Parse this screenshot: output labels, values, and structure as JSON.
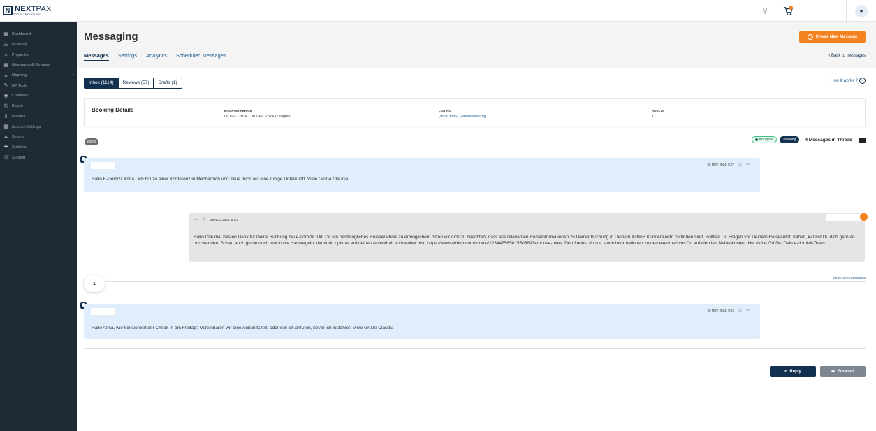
{
  "brand": {
    "logo_mark": "N",
    "name_a": "NEXT",
    "name_b": "PAX",
    "tagline": "TRAVEL TECHNOLOGY"
  },
  "topbar": {
    "search_icon": "search-icon",
    "cart_icon": "cart-icon",
    "user_icon": "user-icon"
  },
  "sidebar": {
    "items": [
      {
        "label": "Dashboard",
        "icon": "▦",
        "chevron": ""
      },
      {
        "label": "Bookings",
        "icon": "▭",
        "chevron": ""
      },
      {
        "label": "Properties",
        "icon": "⌂",
        "chevron": ""
      },
      {
        "label": "Messaging & Reviews",
        "icon": "▦",
        "chevron": ""
      },
      {
        "label": "Mapping",
        "icon": "⅄",
        "chevron": "›"
      },
      {
        "label": "NP Tools",
        "icon": "✎",
        "chevron": ""
      },
      {
        "label": "Channels",
        "icon": "◉",
        "chevron": ""
      },
      {
        "label": "Export",
        "icon": "⇱",
        "chevron": "›"
      },
      {
        "label": "Reports",
        "icon": "▯",
        "chevron": ""
      },
      {
        "label": "Account Settings",
        "icon": "▦",
        "chevron": ""
      },
      {
        "label": "System",
        "icon": "✲",
        "chevron": "›"
      },
      {
        "label": "Statistics",
        "icon": "✚",
        "chevron": ""
      },
      {
        "label": "Support",
        "icon": "☏",
        "chevron": ""
      }
    ]
  },
  "header": {
    "title": "Messaging",
    "create_button": "Create New Message",
    "tabs": [
      "Messages",
      "Settings",
      "Analytics",
      "Scheduled Messages"
    ],
    "back_link": "‹  Back to messages"
  },
  "folders": {
    "inbox": "Inbox (1114)",
    "reviews": "Reviews (57)",
    "drafts": "Drafts (1)",
    "how_it_works": "How it works ?",
    "help_glyph": "?"
  },
  "booking": {
    "title": "Booking Details",
    "period_label": "BOOKING PERIOD",
    "period_value": "06 DEC 2024 - 08 DEC 2024 (2 Nights)",
    "listing_label": "LISTING",
    "listing_id": "(99963385)",
    "listing_name": " Ferienwohnung",
    "adults_label": "ADULTS",
    "adults_value": "1"
  },
  "thread": {
    "folder_pill": "Inbox",
    "status_pill": "Accepted",
    "type_pill": "Booking",
    "count_text": "4 Messages in Thread"
  },
  "messages": [
    {
      "direction": "in",
      "date": "25 NOV 2024, 8:07",
      "text": "Hallo E-Domizil Anna , ich bin zu einer Konferenz in Mechernich und freue mich auf eine ruhige Unterkunft. Viele Grüße Claudia"
    },
    {
      "direction": "out",
      "date": "28 NOV 2024, 8:10",
      "text": "Hallo Claudia, besten Dank für Deine Buchung bei e-domizil. Um Dir ein bestmögliches Reiseerlebnis zu ermöglichen, bitten wir dich zu beachten, dass alle relevanten Reiseinformationen zu Deiner Buchung in Deinem AirBnB Kundenkonto zu finden sind. Solltest Du Fragen vor Deinem Reiseantritt haben, kannst Du dich gern an uns wenden. Schau auch gerne noch mal in die Hausregeln, damit du optimal auf deinen Aufenthalt vorbereitet bist: https://www.airbnb.com/rooms/1234475650155036934/house-rules. Dort findest du u.a. auch Informationen zu den eventuell vor Ort anfallenden Nebenkosten. Herzliche Grüße, Dein e-domizil-Team"
    },
    {
      "direction": "in",
      "date": "29 NOV 2024, 9:22",
      "text": "Hallo Anna, wie funktioniert der Check-in am Freitag? Vereinbaren wir eine Ankunftszeit, oder soll ich anrufen, bevor ich losfahre? Viele Grüße Claudia"
    }
  ],
  "pagination": {
    "number": "1",
    "view_more": "view more messages"
  },
  "actions": {
    "reply": "Reply",
    "forward": "Forward"
  },
  "colors": {
    "accent": "#f58220",
    "navy": "#12304f",
    "sidebar": "#1f2a36",
    "incoming": "#dfeefa",
    "outgoing": "#e5e5e5"
  }
}
